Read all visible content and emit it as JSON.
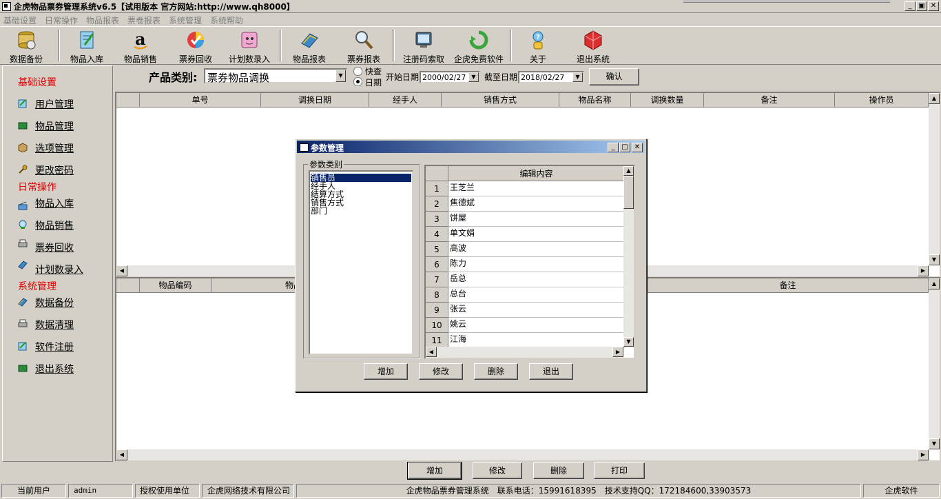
{
  "window": {
    "title": "企虎物品票券管理系统v6.5【试用版本 官方网站:http://www.qh8000】",
    "controls": {
      "minimize": "_",
      "restore": "▣",
      "close": "✕"
    }
  },
  "menu": [
    "基础设置",
    "日常操作",
    "物品报表",
    "票卷报表",
    "系统管理",
    "系统帮助"
  ],
  "toolbar": [
    {
      "label": "数据备份",
      "icon": "database-backup-icon"
    },
    {
      "label": "物品入库",
      "icon": "stock-in-icon"
    },
    {
      "label": "物品销售",
      "icon": "sales-icon"
    },
    {
      "label": "票券回收",
      "icon": "ticket-recycle-icon"
    },
    {
      "label": "计划数录入",
      "icon": "plan-entry-icon"
    },
    {
      "label": "物品报表",
      "icon": "goods-report-icon"
    },
    {
      "label": "票券报表",
      "icon": "ticket-report-icon"
    },
    {
      "label": "注册码索取",
      "icon": "register-code-icon"
    },
    {
      "label": "企虎免费软件",
      "icon": "free-software-icon"
    },
    {
      "label": "关于",
      "icon": "about-icon"
    },
    {
      "label": "退出系统",
      "icon": "exit-icon"
    }
  ],
  "sidebar": {
    "sections": [
      {
        "title": "基础设置",
        "items": [
          "用户管理",
          "物品管理",
          "选项管理",
          "更改密码"
        ]
      },
      {
        "title": "日常操作",
        "items": [
          "物品入库",
          "物品销售",
          "票券回收",
          "计划数录入"
        ]
      },
      {
        "title": "系统管理",
        "items": [
          "数据备份",
          "数据清理",
          "软件注册",
          "退出系统"
        ]
      }
    ]
  },
  "filter": {
    "category_label": "产品类别:",
    "category_value": "票券物品调换",
    "radio_quick": "快查",
    "radio_date": "日期",
    "radio_selected": "日期",
    "start_label": "开始日期",
    "start_value": "2000/02/27",
    "end_label": "截至日期",
    "end_value": "2018/02/27",
    "confirm": "确认"
  },
  "top_grid": {
    "columns": [
      "单号",
      "调换日期",
      "经手人",
      "销售方式",
      "物品名称",
      "调换数量",
      "备注",
      "操作员"
    ]
  },
  "bottom_grid": {
    "columns": [
      "物品编码",
      "物品",
      "备注"
    ]
  },
  "dialog": {
    "title": "参数管理",
    "group_label": "参数类别",
    "categories": [
      "销售员",
      "经手人",
      "结算方式",
      "销售方式",
      "部门"
    ],
    "selected_category": "销售员",
    "grid_header": "编辑内容",
    "rows": [
      {
        "no": "1",
        "value": "王芝兰"
      },
      {
        "no": "2",
        "value": "焦德斌"
      },
      {
        "no": "3",
        "value": "饼屋"
      },
      {
        "no": "4",
        "value": "单文娟"
      },
      {
        "no": "5",
        "value": "高波"
      },
      {
        "no": "6",
        "value": "陈力"
      },
      {
        "no": "7",
        "value": "岳总"
      },
      {
        "no": "8",
        "value": "总台"
      },
      {
        "no": "9",
        "value": "张云"
      },
      {
        "no": "10",
        "value": "姚云"
      },
      {
        "no": "11",
        "value": "江海"
      }
    ],
    "buttons": {
      "add": "增加",
      "edit": "修改",
      "delete": "删除",
      "exit": "退出"
    }
  },
  "bottom_buttons": {
    "add": "增加",
    "edit": "修改",
    "delete": "删除",
    "print": "打印"
  },
  "status": {
    "current_user_label": "当前用户",
    "current_user": "admin",
    "licensee_label": "授权使用单位",
    "licensee": "企虎网络技术有限公司",
    "info": "企虎物品票券管理系统　联系电话：15991618395　技术支持QQ：172184600,33903573",
    "brand": "企虎软件"
  }
}
